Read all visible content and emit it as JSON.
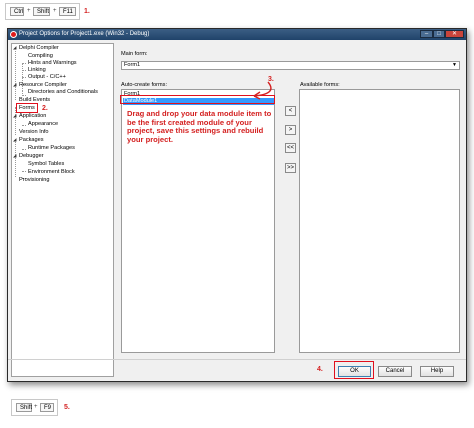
{
  "shortcut1": {
    "keys": [
      "Ctrl",
      "Shift",
      "F11"
    ],
    "plus": "+",
    "step": "1."
  },
  "window": {
    "title": "Project Options for Project1.exe  (Win32 - Debug)",
    "minimize": "–",
    "maximize": "□",
    "close": "✕"
  },
  "tree": {
    "delphi_compiler": "Delphi Compiler",
    "compiling": "Compiling",
    "hints": "Hints and Warnings",
    "linking": "Linking",
    "output": "Output - C/C++",
    "resource_compiler": "Resource Compiler",
    "directories": "Directories and Conditionals",
    "build_events": "Build Events",
    "forms": "Forms",
    "application": "Application",
    "appearance": "Appearance",
    "version_info": "Version Info",
    "packages": "Packages",
    "runtime_packages": "Runtime Packages",
    "debugger": "Debugger",
    "symbol_tables": "Symbol Tables",
    "environment_block": "Environment Block",
    "provisioning": "Provisioning",
    "expand_glyph": "◢"
  },
  "main_form": {
    "label": "Main form:",
    "value": "Form1"
  },
  "auto_create": {
    "label": "Auto-create forms:",
    "items": [
      "Form1",
      "DataModule1"
    ]
  },
  "available": {
    "label": "Available forms:"
  },
  "move": {
    "left": "<",
    "right": ">",
    "all_left": "<<",
    "all_right": ">>"
  },
  "note": "Drag and drop your data module item to be the first created module of your project, save this settings and rebuild your project.",
  "buttons": {
    "ok": "OK",
    "cancel": "Cancel",
    "help": "Help"
  },
  "steps": {
    "forms": "2.",
    "drag": "3.",
    "ok": "4."
  },
  "shortcut2": {
    "keys": [
      "Shift",
      "F9"
    ],
    "plus": "+",
    "step": "5."
  },
  "colors": {
    "annotation": "#d42121",
    "selection": "#3399ff"
  }
}
